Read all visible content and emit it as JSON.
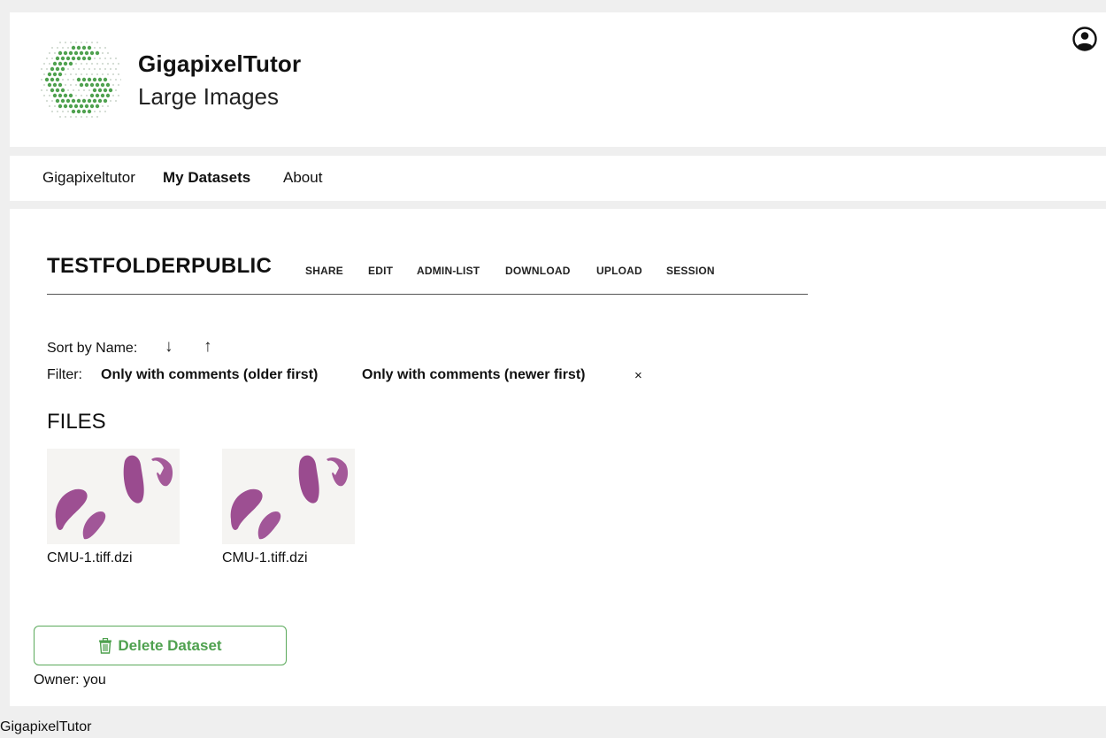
{
  "header": {
    "brand_title": "GigapixelTutor",
    "brand_subtitle": "Large Images",
    "logo_icon": "gigapixel-dot-g-logo",
    "user_icon": "account-circle-icon",
    "accent_color": "#4fa14f"
  },
  "nav": {
    "items": [
      {
        "label": "Gigapixeltutor",
        "active": false
      },
      {
        "label": "My Datasets",
        "active": true
      },
      {
        "label": "About",
        "active": false
      }
    ]
  },
  "dataset": {
    "title": "TESTFOLDERPUBLIC",
    "actions": [
      "SHARE",
      "EDIT",
      "ADMIN-LIST",
      "DOWNLOAD",
      "UPLOAD",
      "SESSION"
    ]
  },
  "sort": {
    "label": "Sort by Name:",
    "desc_icon": "↓",
    "asc_icon": "↑"
  },
  "filter": {
    "label": "Filter:",
    "options": [
      "Only with comments (older first)",
      "Only with comments (newer first)"
    ],
    "clear": "×"
  },
  "files": {
    "heading": "FILES",
    "items": [
      {
        "name": "CMU-1.tiff.dzi"
      },
      {
        "name": "CMU-1.tiff.dzi"
      }
    ]
  },
  "delete_button": {
    "label": "Delete Dataset",
    "icon": "trash-icon"
  },
  "owner": "Owner: you",
  "footer": "GigapixelTutor"
}
